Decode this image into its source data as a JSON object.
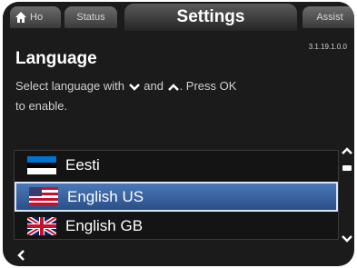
{
  "tabs": {
    "home": "Ho",
    "status": "Status",
    "settings": "Settings",
    "assist": "Assist"
  },
  "version": "3.1.19.1.0.0",
  "page": {
    "title": "Language",
    "instruction_prefix": "Select language with",
    "instruction_and": "and",
    "instruction_suffix": ". Press OK",
    "instruction_line2": "to enable."
  },
  "languages": [
    {
      "label": "Eesti",
      "flag": "estonia-flag"
    },
    {
      "label": "English US",
      "flag": "usa-flag",
      "selected": true
    },
    {
      "label": "English GB",
      "flag": "uk-flag"
    }
  ],
  "icons": {
    "home": "home-icon",
    "down": "chevron-down-icon",
    "up": "chevron-up-icon",
    "back": "back-arrow-icon"
  },
  "colors": {
    "selection": "#3a64a8",
    "background": "#1b1b1b"
  }
}
